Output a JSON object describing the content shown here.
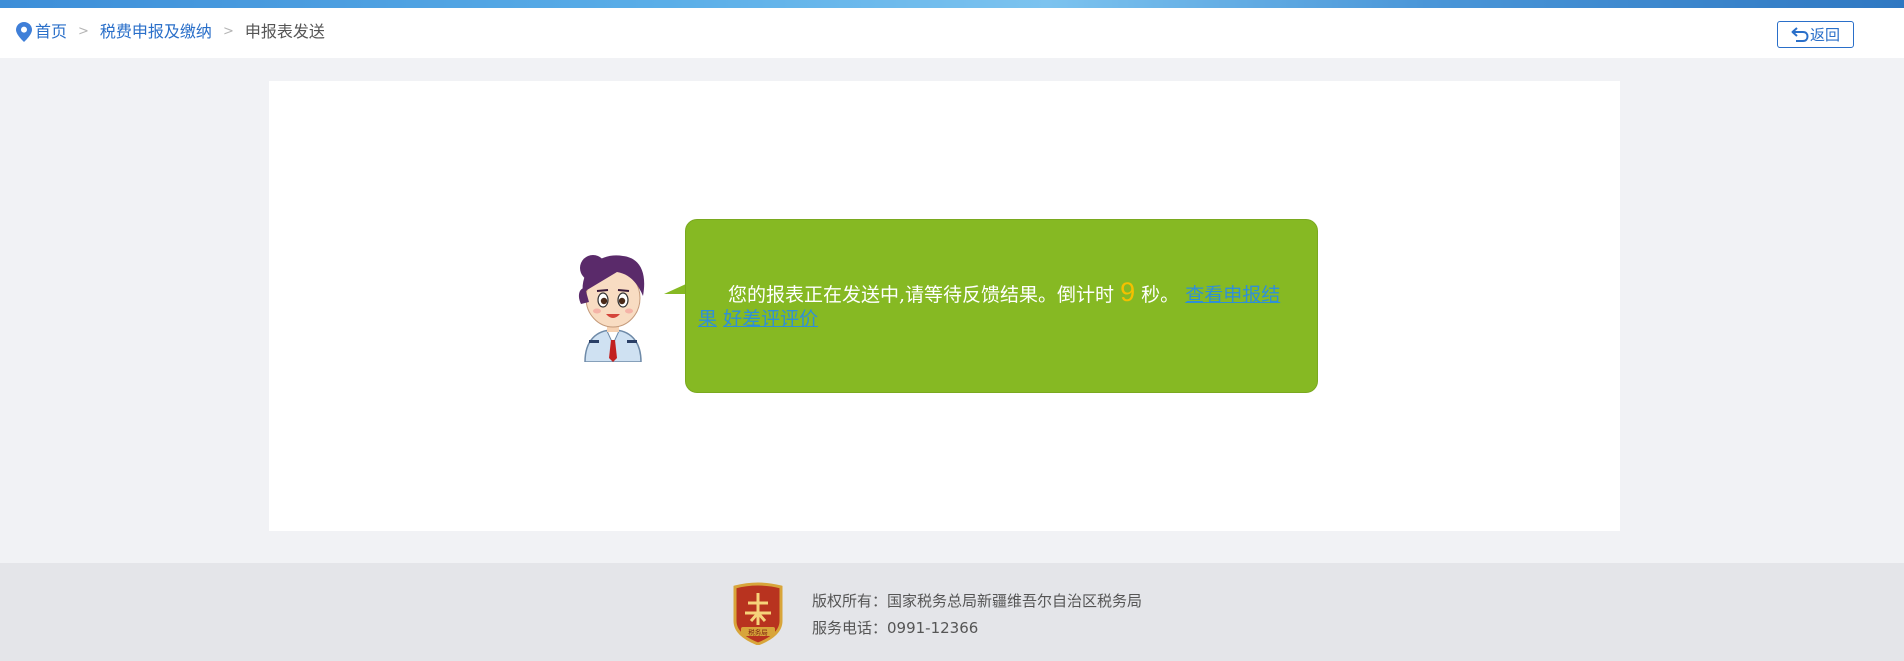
{
  "breadcrumb": {
    "home": "首页",
    "level2": "税费申报及缴纳",
    "current": "申报表发送",
    "separator": ">"
  },
  "header": {
    "back_label": "返回"
  },
  "message": {
    "text_before": "您的报表正在发送中,请等待反馈结果。倒计时 ",
    "countdown": "9",
    "text_after": " 秒。 ",
    "link_view_result": "查看申报结果",
    "link_evaluate": "好差评评价"
  },
  "footer": {
    "copyright": "版权所有：国家税务总局新疆维吾尔自治区税务局",
    "phone": "服务电话：0991-12366",
    "emblem_text": "税务局"
  },
  "colors": {
    "accent": "#2a6fc9",
    "bubble": "#86b923",
    "countdown": "#f5c000",
    "link": "#2f8fd8"
  }
}
